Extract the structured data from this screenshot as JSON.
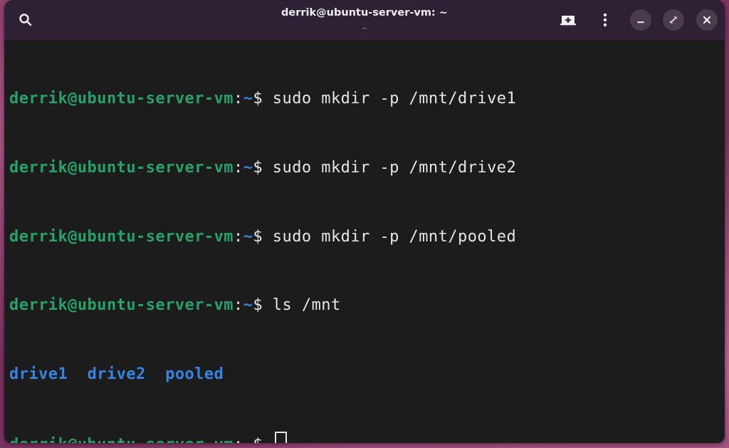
{
  "window": {
    "title": "derrik@ubuntu-server-vm: ~",
    "subtitle": "~"
  },
  "headerbar": {
    "icons": {
      "search": "search-icon",
      "new_tab": "new-tab-icon",
      "menu": "kebab-menu-icon",
      "minimize": "minimize-icon",
      "maximize": "restore-icon",
      "close": "close-icon"
    }
  },
  "terminal": {
    "prompt": {
      "user_host": "derrik@ubuntu-server-vm",
      "colon": ":",
      "path": "~",
      "symbol": "$"
    },
    "lines": [
      {
        "command": " sudo mkdir -p /mnt/drive1"
      },
      {
        "command": " sudo mkdir -p /mnt/drive2"
      },
      {
        "command": " sudo mkdir -p /mnt/pooled"
      },
      {
        "command": " ls /mnt"
      }
    ],
    "ls_output": [
      "drive1",
      "drive2",
      "pooled"
    ],
    "current_input": " "
  },
  "colors": {
    "prompt_user": "#26a269",
    "prompt_path": "#3584e4",
    "directory": "#3584e4",
    "background": "#1c1c1c",
    "headerbar": "#2e2133"
  }
}
